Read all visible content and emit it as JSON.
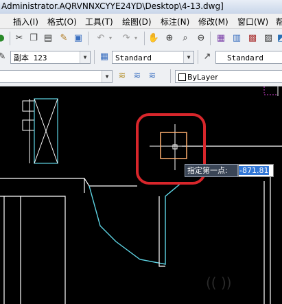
{
  "window": {
    "title": "Administrator.AQRVNNXCYYE24YD\\Desktop\\4-13.dwg]"
  },
  "menu": {
    "items": [
      {
        "label": "插入(I)"
      },
      {
        "label": "格式(O)"
      },
      {
        "label": "工具(T)"
      },
      {
        "label": "绘图(D)"
      },
      {
        "label": "标注(N)"
      },
      {
        "label": "修改(M)"
      },
      {
        "label": "窗口(W)"
      },
      {
        "label": "帮"
      }
    ]
  },
  "toolbar_styles": {
    "text_style": "副本 123",
    "table_style": "Standard",
    "multileader_style": "Standard"
  },
  "toolbar_layers": {
    "color": "ByLayer"
  },
  "command_input": {
    "prompt": "指定第一点:",
    "value": "-871.81"
  },
  "colors": {
    "geometry_cyan": "#5fd6e6",
    "geometry_white": "#ffffff",
    "annotation_red": "#d8262b",
    "cursor_box": "#ffb070"
  }
}
